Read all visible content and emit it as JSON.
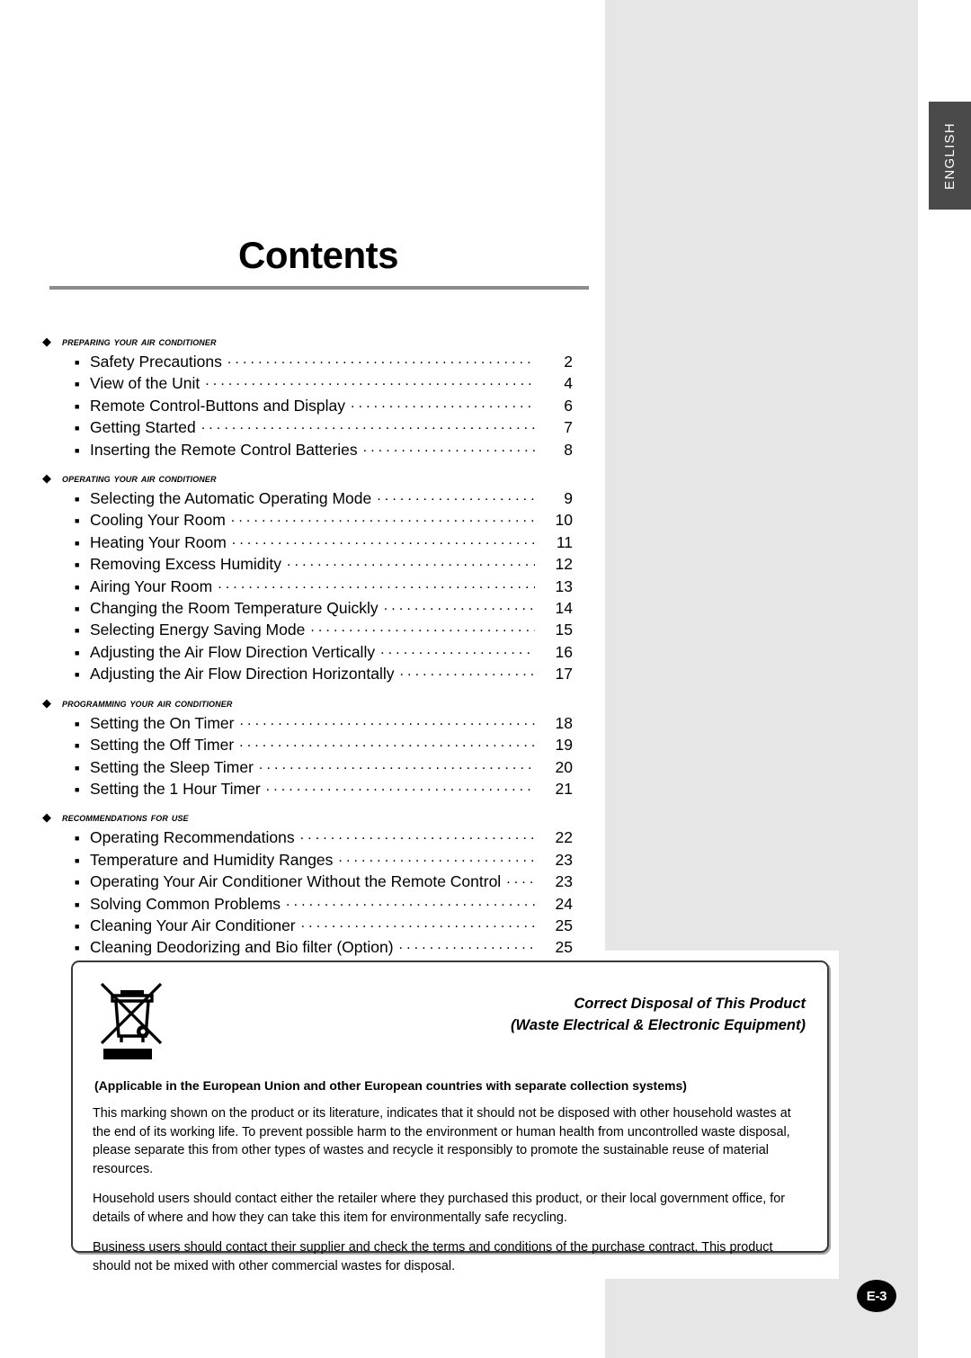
{
  "document": {
    "title": "Contents",
    "language_tab": "ENGLISH",
    "page_number": "E-3"
  },
  "icons": {
    "section_bullet": "◆",
    "entry_bullet": "■"
  },
  "toc": {
    "sections": [
      {
        "heading": "PREPARING YOUR AIR CONDITIONER",
        "entries": [
          {
            "label": "Safety Precautions",
            "page": "2"
          },
          {
            "label": "View of the Unit",
            "page": "4"
          },
          {
            "label": "Remote Control-Buttons and Display",
            "page": "6"
          },
          {
            "label": "Getting Started",
            "page": "7"
          },
          {
            "label": "Inserting the Remote Control Batteries",
            "page": "8"
          }
        ]
      },
      {
        "heading": "OPERATING YOUR AIR CONDITIONER",
        "entries": [
          {
            "label": "Selecting the Automatic Operating Mode",
            "page": "9"
          },
          {
            "label": "Cooling Your Room",
            "page": "10"
          },
          {
            "label": "Heating Your Room",
            "page": "11"
          },
          {
            "label": "Removing Excess Humidity",
            "page": "12"
          },
          {
            "label": "Airing Your Room",
            "page": "13"
          },
          {
            "label": "Changing the Room Temperature Quickly",
            "page": "14"
          },
          {
            "label": "Selecting Energy Saving Mode",
            "page": "15"
          },
          {
            "label": "Adjusting the Air Flow Direction Vertically",
            "page": "16"
          },
          {
            "label": "Adjusting the Air Flow Direction Horizontally",
            "page": "17"
          }
        ]
      },
      {
        "heading": "PROGRAMMING YOUR AIR CONDITIONER",
        "entries": [
          {
            "label": "Setting the On Timer",
            "page": "18"
          },
          {
            "label": "Setting the Off Timer",
            "page": "19"
          },
          {
            "label": "Setting the Sleep Timer",
            "page": "20"
          },
          {
            "label": "Setting the 1 Hour Timer",
            "page": "21"
          }
        ]
      },
      {
        "heading": "RECOMMENDATIONS FOR USE",
        "entries": [
          {
            "label": "Operating Recommendations",
            "page": "22"
          },
          {
            "label": "Temperature and Humidity Ranges",
            "page": "23"
          },
          {
            "label": "Operating Your Air Conditioner Without the Remote Control",
            "page": "23"
          },
          {
            "label": "Solving Common Problems",
            "page": "24"
          },
          {
            "label": "Cleaning Your Air Conditioner",
            "page": "25"
          },
          {
            "label": "Cleaning Deodorizing and Bio filter (Option)",
            "page": "25"
          }
        ]
      }
    ]
  },
  "disposal_notice": {
    "icon_name": "weee-crossed-out-wheelie-bin-icon",
    "heading_line1": "Correct Disposal of This Product",
    "heading_line2": "(Waste Electrical & Electronic Equipment)",
    "applicable": "(Applicable in the European Union and other European countries with separate collection systems)",
    "paragraphs": [
      "This marking shown on the product or its literature, indicates that it should not be disposed with other household wastes at the end of its working life. To prevent possible harm to the environment or human health from uncontrolled waste disposal, please separate this from other types of wastes and recycle it responsibly to promote the sustainable reuse of material resources.",
      "Household users should contact either the retailer where they purchased this product, or their local government office, for details of where and how they can take this item for environmentally safe recycling.",
      "Business users should contact their supplier and check the terms and conditions of the purchase contract. This product should not be mixed with other commercial wastes for disposal."
    ]
  },
  "colors": {
    "panel_gray": "#e6e6e6",
    "tab_dark": "#4a4a4a",
    "rule_gray": "#8c8c8c",
    "box_border": "#3a3a3a"
  }
}
